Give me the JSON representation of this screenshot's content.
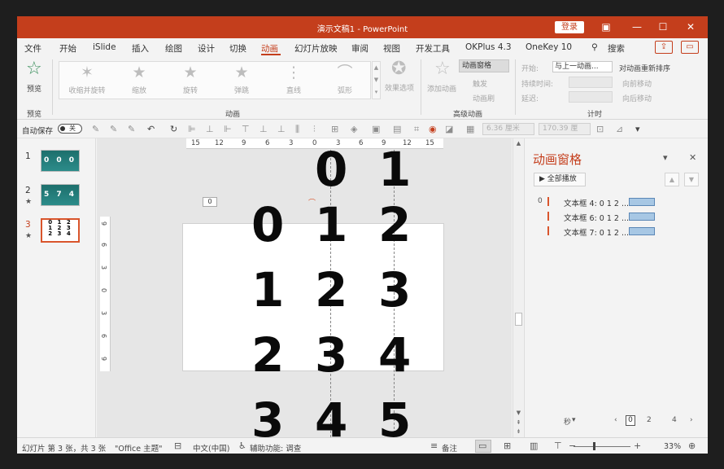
{
  "window": {
    "title": "演示文稿1  -  PowerPoint",
    "login": "登录",
    "controls": [
      "▣",
      "—",
      "☐",
      "✕"
    ]
  },
  "menu": {
    "tabs": [
      "文件",
      "开始",
      "iSlide",
      "插入",
      "绘图",
      "设计",
      "切换",
      "动画",
      "幻灯片放映",
      "审阅",
      "视图",
      "开发工具",
      "OKPlus 4.3",
      "OneKey 10"
    ],
    "active": "动画",
    "search": "搜索",
    "search_icon": "⚲"
  },
  "ribbon": {
    "preview": {
      "label": "预览",
      "group": "预览",
      "icon": "☆"
    },
    "gallery": [
      {
        "label": "收缩并旋转",
        "icon": "✶"
      },
      {
        "label": "缩放",
        "icon": "★"
      },
      {
        "label": "旋转",
        "icon": "★"
      },
      {
        "label": "弹跳",
        "icon": "★"
      },
      {
        "label": "直线",
        "icon": "⋮"
      },
      {
        "label": "弧形",
        "icon": "⌒"
      }
    ],
    "effect_options": "效果选项",
    "group_animation": "动画",
    "advanced": {
      "add_animation": "添加动画",
      "pane": "动画窗格",
      "trigger": "触发",
      "painter": "动画刷",
      "group": "高级动画"
    },
    "timing": {
      "start_label": "开始:",
      "start_value": "与上一动画...",
      "duration_label": "持续时间:",
      "delay_label": "延迟:",
      "reorder": "对动画重新排序",
      "move_earlier": "向前移动",
      "move_later": "向后移动",
      "group": "计时"
    }
  },
  "qat": {
    "autosave": "自动保存",
    "toggle": "关",
    "width_value": "6.36 厘米",
    "height_value": "170.39 厘"
  },
  "thumbnails": [
    {
      "num": "1",
      "text": "0 0 0",
      "star": ""
    },
    {
      "num": "2",
      "text": "5 7 4",
      "star": "★"
    },
    {
      "num": "3",
      "text": "0 1 2\n1 2 3\n2 3 4",
      "star": "★"
    }
  ],
  "rulers": {
    "h": [
      "15",
      "12",
      "9",
      "6",
      "3",
      "0",
      "3",
      "6",
      "9",
      "12",
      "15"
    ],
    "v": [
      "9",
      "6",
      "3",
      "0",
      "3",
      "6",
      "9"
    ]
  },
  "canvas": {
    "tag": "0",
    "top_row": [
      "0",
      "1"
    ],
    "grid": [
      [
        "0",
        "1",
        "2"
      ],
      [
        "1",
        "2",
        "3"
      ],
      [
        "2",
        "3",
        "4"
      ],
      [
        "3",
        "4",
        "5"
      ]
    ]
  },
  "anim_pane": {
    "title": "动画窗格",
    "play_all": "全部播放",
    "play_icon": "▶",
    "items": [
      {
        "num": "0",
        "label": "文本框 4: 0 1 2 ..."
      },
      {
        "num": "",
        "label": "文本框 6: 0 1 2 ..."
      },
      {
        "num": "",
        "label": "文本框 7: 0 1 2 ..."
      }
    ],
    "seconds": "秒",
    "timeline": [
      "0",
      "2",
      "4"
    ]
  },
  "status": {
    "slide_info": "幻灯片 第 3 张，共 3 张",
    "theme": "\"Office 主题\"",
    "language": "中文(中国)",
    "accessibility": "辅助功能: 调查",
    "notes": "备注",
    "zoom": "33%"
  },
  "colors": {
    "accent": "#c43e1c",
    "anim_bar": "#a7c7e4"
  }
}
